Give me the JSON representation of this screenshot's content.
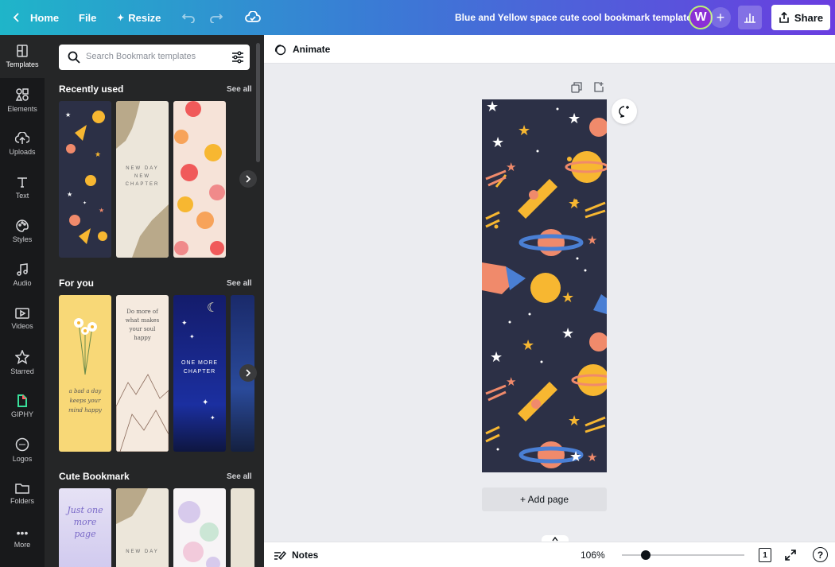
{
  "topbar": {
    "home_label": "Home",
    "file_label": "File",
    "resize_label": "Resize",
    "doc_title": "Blue and Yellow space cute cool bookmark template",
    "avatar_initial": "W",
    "share_label": "Share"
  },
  "rail": {
    "items": [
      {
        "label": "Templates",
        "icon": "templates-icon"
      },
      {
        "label": "Elements",
        "icon": "elements-icon"
      },
      {
        "label": "Uploads",
        "icon": "cloud-upload-icon"
      },
      {
        "label": "Text",
        "icon": "text-icon"
      },
      {
        "label": "Styles",
        "icon": "palette-icon"
      },
      {
        "label": "Audio",
        "icon": "music-note-icon"
      },
      {
        "label": "Videos",
        "icon": "video-icon"
      },
      {
        "label": "Starred",
        "icon": "star-icon"
      },
      {
        "label": "GIPHY",
        "icon": "giphy-icon"
      },
      {
        "label": "Logos",
        "icon": "logo-icon"
      },
      {
        "label": "Folders",
        "icon": "folder-icon"
      },
      {
        "label": "More",
        "icon": "more-icon"
      }
    ]
  },
  "panel": {
    "search_placeholder": "Search Bookmark templates",
    "sections": [
      {
        "title": "Recently used",
        "see_all": "See all"
      },
      {
        "title": "For you",
        "see_all": "See all"
      },
      {
        "title": "Cute Bookmark",
        "see_all": "See all"
      }
    ],
    "thumb_text": {
      "new_day": "NEW DAY NEW CHAPTER",
      "do_more": "Do more of what makes your soul happy",
      "one_more": "ONE MORE CHAPTER",
      "bad_day": "a bad a day keeps your mind happy",
      "just_one": "Just one more page",
      "new_day2": "NEW DAY"
    }
  },
  "editor": {
    "animate_label": "Animate",
    "add_page_label": "+ Add page",
    "notes_label": "Notes",
    "zoom_label": "106%",
    "page_count": "1"
  },
  "colors": {
    "accent_gradient_start": "#1fb5c9",
    "accent_gradient_end": "#6a3de0",
    "bookmark_bg": "#2c3046",
    "yellow": "#f7b731",
    "coral": "#f08a6b",
    "blue": "#4a7fd4"
  }
}
